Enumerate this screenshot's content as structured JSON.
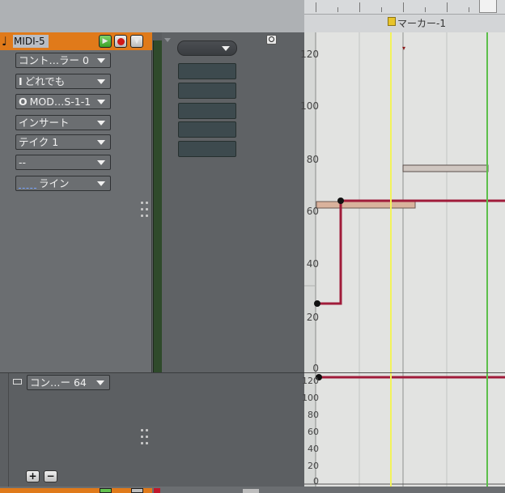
{
  "ruler": {
    "marker_label": "マーカー-1"
  },
  "track": {
    "name": "MIDI-5",
    "combos": [
      {
        "label": "コント…ラー 0",
        "prefix": ""
      },
      {
        "label": "どれでも",
        "prefix": "I"
      },
      {
        "label": "MOD…S-1-1",
        "prefix": "O"
      },
      {
        "label": "インサート",
        "prefix": ""
      },
      {
        "label": "テイク 1",
        "prefix": ""
      },
      {
        "label": "--",
        "prefix": ""
      },
      {
        "label": "ライン",
        "prefix": ""
      }
    ]
  },
  "lane": {
    "controller_label": "コン…ー 64",
    "plus": "+",
    "minus": "−",
    "axis_ticks": [
      "120",
      "100",
      "80",
      "60",
      "40",
      "20",
      "0"
    ]
  },
  "roll": {
    "axis_ticks": [
      "120",
      "100",
      "80",
      "60",
      "40",
      "20",
      "0"
    ]
  },
  "colors": {
    "track_header": "#e07a1a",
    "automation_line": "#a01c3a",
    "cursor_yellow": "#f3f35a",
    "cursor_green": "#5cbf4a"
  }
}
